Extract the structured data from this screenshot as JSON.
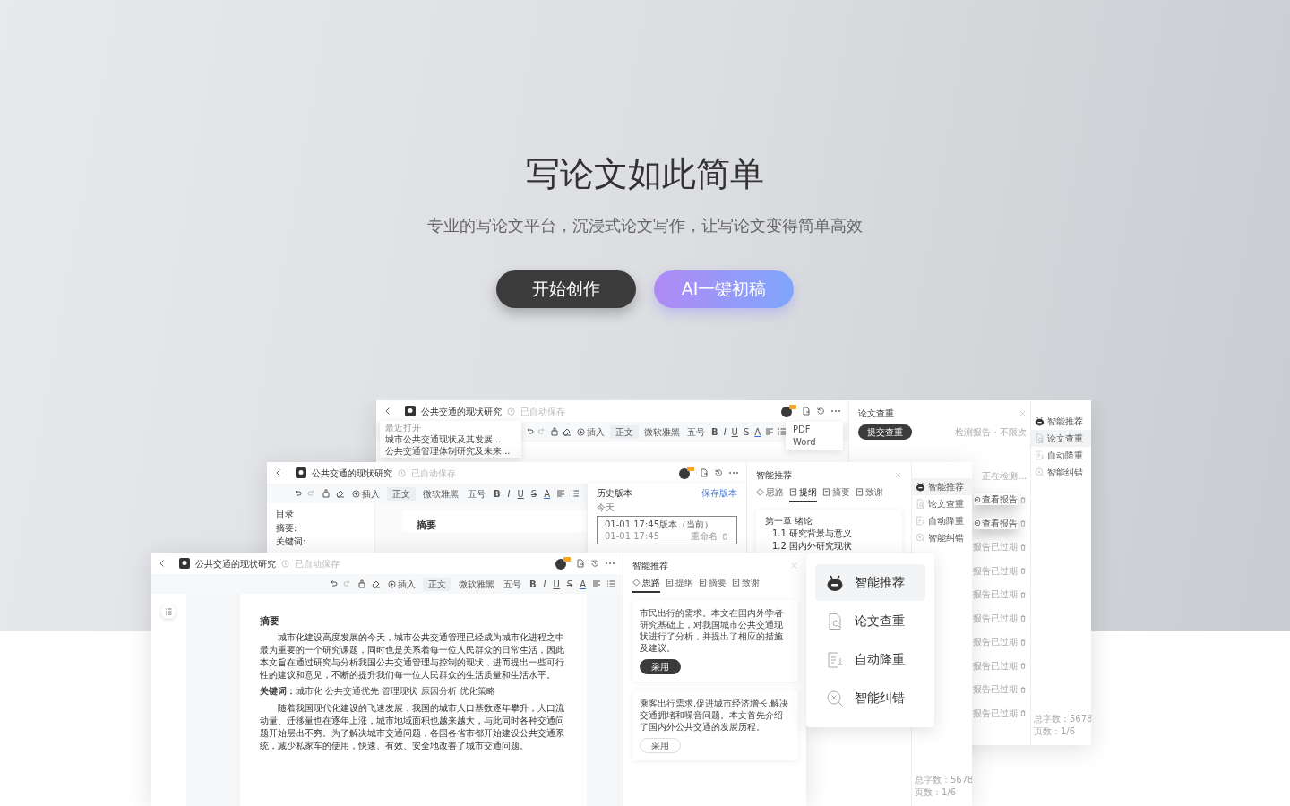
{
  "hero": {
    "title": "写论文如此简单",
    "subtitle": "专业的写论文平台，沉浸式论文写作，让写论文变得简单高效",
    "buttons": [
      {
        "label": "开始创作",
        "kind": "dark"
      },
      {
        "label": "AI一键初稿",
        "kind": "gradient"
      }
    ]
  },
  "windows": [
    {
      "doc_title": "公共交通的现状研究",
      "save_status": "已自动保存",
      "toolbar": [
        "插入",
        "正文",
        "微软雅黑",
        "五号"
      ],
      "format_buttons": [
        "B",
        "I",
        "U",
        "S",
        "A"
      ],
      "recent": {
        "label": "最近打开",
        "items": [
          "城市公共交通现状及其发展...",
          "公共交通管理体制研究及未来..."
        ]
      },
      "export_menu": [
        "PDF",
        "Word"
      ],
      "panels": [
        {
          "kind": "check",
          "title": "论文查重",
          "submit": "提交查重",
          "note": "检测报告 · 不限次",
          "records": [
            {
              "kind": "checking",
              "status": "正在检测..."
            },
            {
              "kind": "report",
              "status": "查看报告"
            },
            {
              "kind": "report",
              "status": "查看报告"
            },
            {
              "kind": "expired",
              "status": "报告已过期"
            },
            {
              "kind": "expired",
              "status": "报告已过期"
            },
            {
              "kind": "expired",
              "status": "报告已过期"
            },
            {
              "kind": "expired",
              "status": "报告已过期"
            },
            {
              "kind": "expired",
              "status": "报告已过期"
            },
            {
              "kind": "expired",
              "status": "报告已过期"
            },
            {
              "kind": "expired",
              "status": "报告已过期"
            },
            {
              "kind": "expired",
              "status": "报告已过期"
            }
          ]
        }
      ],
      "rail": {
        "items": [
          {
            "label": "智能推荐",
            "selected": false
          },
          {
            "label": "论文查重",
            "selected": true
          },
          {
            "label": "自动降重",
            "selected": false
          },
          {
            "label": "智能纠错",
            "selected": false
          }
        ],
        "footer": [
          "总字数：5678",
          "页数：1/6"
        ]
      }
    },
    {
      "doc_title": "公共交通的现状研究",
      "save_status": "已自动保存",
      "toolbar": [
        "插入",
        "正文",
        "微软雅黑",
        "五号"
      ],
      "format_buttons": [
        "B",
        "I",
        "U",
        "S",
        "A"
      ],
      "doc": {
        "kind": "outline",
        "toc_title": "目录",
        "toc": [
          "摘要:",
          "关键词:"
        ],
        "heading": "摘要"
      },
      "history": {
        "title": "历史版本",
        "action": "保存版本",
        "group": "今天",
        "versions": [
          {
            "name": "01-01 17:45版本（当前）",
            "time": "01-01 17:45",
            "rename": "重命名",
            "selected": true
          }
        ]
      },
      "panels": [
        {
          "kind": "outline",
          "title": "智能推荐",
          "tabs": [
            {
              "label": "思路",
              "selected": false
            },
            {
              "label": "提纲",
              "selected": true
            },
            {
              "label": "摘要",
              "selected": false
            },
            {
              "label": "致谢",
              "selected": false
            }
          ],
          "items": [
            {
              "label": "第一章 绪论",
              "children": [
                {
                  "label": "1.1 研究背景与意义"
                },
                {
                  "label": "1.2 国内外研究现状"
                }
              ]
            }
          ]
        }
      ],
      "rail": {
        "items": [
          {
            "label": "智能推荐",
            "selected": true
          },
          {
            "label": "论文查重",
            "selected": false
          },
          {
            "label": "自动降重",
            "selected": false
          },
          {
            "label": "智能纠错",
            "selected": false
          }
        ],
        "footer": [
          "总字数：5678",
          "页数：1/6"
        ]
      }
    },
    {
      "doc_title": "公共交通的现状研究",
      "save_status": "已自动保存",
      "toolbar": [
        "插入",
        "正文",
        "微软雅黑",
        "五号"
      ],
      "format_buttons": [
        "B",
        "I",
        "U",
        "S",
        "A"
      ],
      "doc": {
        "kind": "page",
        "heading": "摘要",
        "blocks": [
          {
            "kind": "para",
            "text": "城市化建设高度发展的今天，城市公共交通管理已经成为城市化进程之中最为重要的一个研究课题，同时也是关系着每一位人民群众的日常生活，因此本文旨在通过研究与分析我国公共交通管理与控制的现状，进而提出一些可行性的建议和意见，不断的提升我们每一位人民群众的生活质量和生活水平。"
          },
          {
            "kind": "keywords",
            "text": "**关键词：**城市化  公共交通优先  管理现状  原因分析  优化策略"
          },
          {
            "kind": "para",
            "text": "随着我国现代化建设的飞速发展，我国的城市人口基数逐年攀升，人口流动量、迁移量也在逐年上涨，城市地域面积也越来越大，与此同时各种交通问题开始层出不穷。为了解决城市交通问题，各国各省市都开始建设公共交通系统，减少私家车的使用，快速、有效、安全地改善了城市交通问题。"
          }
        ]
      },
      "panels": [
        {
          "kind": "ideas",
          "title": "智能推荐",
          "tabs": [
            {
              "label": "思路",
              "selected": true
            },
            {
              "label": "提纲",
              "selected": false
            },
            {
              "label": "摘要",
              "selected": false
            },
            {
              "label": "致谢",
              "selected": false
            }
          ],
          "cards": [
            {
              "text": "市民出行的需求。本文在国内外学者研究基础上，对我国城市公共交通现状进行了分析，并提出了相应的措施及建议。",
              "button": "采用",
              "primary": true
            },
            {
              "text": "乘客出行需求,促进城市经济增长,解决交通拥堵和噪音问题。本文首先介绍了国内外公共交通的发展历程。",
              "button": "采用",
              "primary": false
            }
          ]
        }
      ],
      "menu": [
        {
          "label": "智能推荐",
          "selected": true
        },
        {
          "label": "论文查重",
          "selected": false
        },
        {
          "label": "自动降重",
          "selected": false
        },
        {
          "label": "智能纠错",
          "selected": false
        }
      ]
    }
  ]
}
